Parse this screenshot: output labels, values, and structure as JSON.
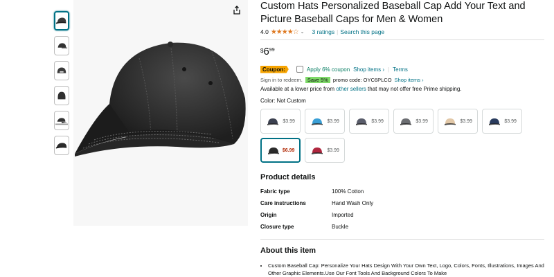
{
  "product": {
    "title": "Custom Hats Personalized Baseball Cap Add Your Text and Picture Baseball Caps for Men & Women",
    "rating": "4.0",
    "stars": "★★★★☆",
    "ratings_count": "3 ratings",
    "search_link": "Search this page"
  },
  "price": {
    "currency": "$",
    "whole": "6",
    "fraction": "99"
  },
  "coupon": {
    "badge": "Coupon:",
    "apply_text": "Apply 6% coupon",
    "shop_items": "Shop items ›",
    "terms": "Terms"
  },
  "promo": {
    "sign_in": "Sign in to redeem.",
    "save_badge": "Save 5%",
    "code_text": "promo code: OYC6PLCO",
    "shop_items": "Shop items ›"
  },
  "availability": {
    "prefix": "Available at a lower price from ",
    "link": "other sellers",
    "suffix": " that may not offer free Prime shipping."
  },
  "color": {
    "label": "Color: Not Custom"
  },
  "swatches": [
    {
      "price": "$3.99",
      "color": "#3c4150",
      "selected": false
    },
    {
      "price": "$3.99",
      "color": "#3a9fd6",
      "selected": false
    },
    {
      "price": "$3.99",
      "color": "#5a5d6b",
      "selected": false
    },
    {
      "price": "$3.99",
      "color": "#6c6e72",
      "selected": false
    },
    {
      "price": "$3.99",
      "color": "#e2c8a8",
      "selected": false
    },
    {
      "price": "$3.99",
      "color": "#2a3c5e",
      "selected": false
    },
    {
      "price": "$6.99",
      "color": "#2b2b2b",
      "selected": true
    },
    {
      "price": "$3.99",
      "color": "#b0273f",
      "selected": false
    }
  ],
  "product_details": {
    "title": "Product details",
    "rows": [
      {
        "key": "Fabric type",
        "value": "100% Cotton"
      },
      {
        "key": "Care instructions",
        "value": "Hand Wash Only"
      },
      {
        "key": "Origin",
        "value": "Imported"
      },
      {
        "key": "Closure type",
        "value": "Buckle"
      }
    ]
  },
  "about": {
    "title": "About this item",
    "bullets": [
      "Custom Baseball Cap: Personalize Your Hats Design With Your Own Text, Logo, Colors, Fonts, Illustrations, Images And Other Graphic Elements.Use Our Font Tools And Background Colors To Make"
    ]
  },
  "thumbnails": [
    "cap-front",
    "cap-side",
    "cap-back-strap",
    "cap-back",
    "cap-model",
    "cap-flat"
  ],
  "colors": {
    "link": "#007185",
    "star": "#de7921",
    "coupon_badge": "#f7a400",
    "save_badge": "#7fda69",
    "coupon_text": "#067d62"
  }
}
